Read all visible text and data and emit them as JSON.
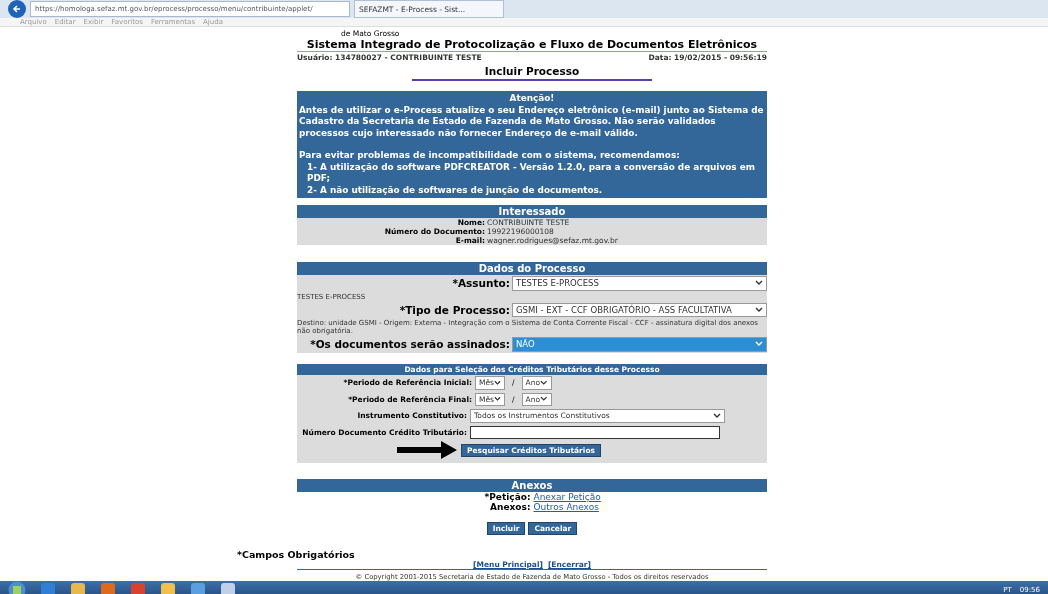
{
  "browser": {
    "address": "https://homologa.sefaz.mt.gov.br/eprocess/processo/menu/contribuinte/applet/",
    "tab": "SEFAZMT - E-Process - Sist...",
    "menu": [
      "Arquivo",
      "Editar",
      "Exibir",
      "Favoritos",
      "Ferramentas",
      "Ajuda"
    ]
  },
  "page": {
    "org": "de Mato Grosso",
    "title": "Sistema Integrado de Protocolização e Fluxo de Documentos Eletrônicos",
    "user": "Usuário: 134780027 - CONTRIBUINTE TESTE",
    "date": "Data: 19/02/2015 - 09:56:19",
    "heading": "Incluir Processo"
  },
  "notice": {
    "title": "Atenção!",
    "paragraphs": [
      "Antes de utilizar o e-Process atualize o seu Endereço eletrônico (e-mail) junto ao Sistema de Cadastro da Secretaria de Estado de Fazenda de Mato Grosso. Não serão validados processos cujo interessado não fornecer Endereço de e-mail válido.",
      "Para evitar problemas de incompatibilidade com o sistema, recomendamos:"
    ],
    "items": [
      "1- A utilização do software PDFCREATOR - Versão 1.2.0, para a conversão de arquivos em PDF;",
      "2- A não utilização de softwares de junção de documentos."
    ]
  },
  "interessado": {
    "title": "Interessado",
    "fields": [
      {
        "label": "Nome:",
        "value": "CONTRIBUINTE TESTE"
      },
      {
        "label": "Número do Documento:",
        "value": "19922196000108"
      },
      {
        "label": "E-mail:",
        "value": "wagner.rodrigues@sefaz.mt.gov.br"
      }
    ]
  },
  "processo": {
    "title": "Dados do Processo",
    "rows": [
      {
        "kind": "select",
        "label": "*Assunto:",
        "value": "TESTES E-PROCESS",
        "highlighted": false
      },
      {
        "kind": "note",
        "text": "TESTES E-PROCESS"
      },
      {
        "kind": "select",
        "label": "*Tipo de Processo:",
        "value": "GSMI - EXT - CCF OBRIGATÓRIO - ASS FACULTATIVA",
        "highlighted": false
      },
      {
        "kind": "note",
        "text": "Destino: unidade GSMI - Origem: Externa - Integração com o Sistema de Conta Corrente Fiscal - CCF - assinatura digital dos anexos não obrigatória."
      },
      {
        "kind": "select",
        "label": "*Os documentos serão assinados:",
        "value": "NÃO",
        "highlighted": true
      }
    ]
  },
  "creditos": {
    "title": "Dados para Seleção dos Créditos Tributários desse Processo",
    "rows": [
      {
        "kind": "period",
        "label": "*Periodo de Referência Inicial:",
        "month": "Mês",
        "separator": "/",
        "year": "Ano"
      },
      {
        "kind": "period",
        "label": "*Periodo de Referência Final:",
        "month": "Mês",
        "separator": "/",
        "year": "Ano"
      },
      {
        "kind": "select",
        "label": "Instrumento Constitutivo:",
        "value": "Todos os Instrumentos Constitutivos"
      },
      {
        "kind": "input",
        "label": "Número Documento Crédito Tributário:"
      }
    ],
    "button": "Pesquisar Créditos Tributários"
  },
  "anexos": {
    "title": "Anexos",
    "rows": [
      {
        "label": "*Petição:",
        "link": "Anexar Petição"
      },
      {
        "label": "Anexos:",
        "link": "Outros Anexos"
      }
    ]
  },
  "buttons": [
    "Incluir",
    "Cancelar"
  ],
  "required_note": "*Campos Obrigatórios",
  "footer_links": [
    "[Menu Principal]",
    "[Encerrar]"
  ],
  "copyright": "© Copyright 2001-2015 Secretaria de Estado de Fazenda de Mato Grosso - Todos os direitos reservados",
  "taskbar": {
    "language": "PT",
    "clock": "09:56"
  }
}
